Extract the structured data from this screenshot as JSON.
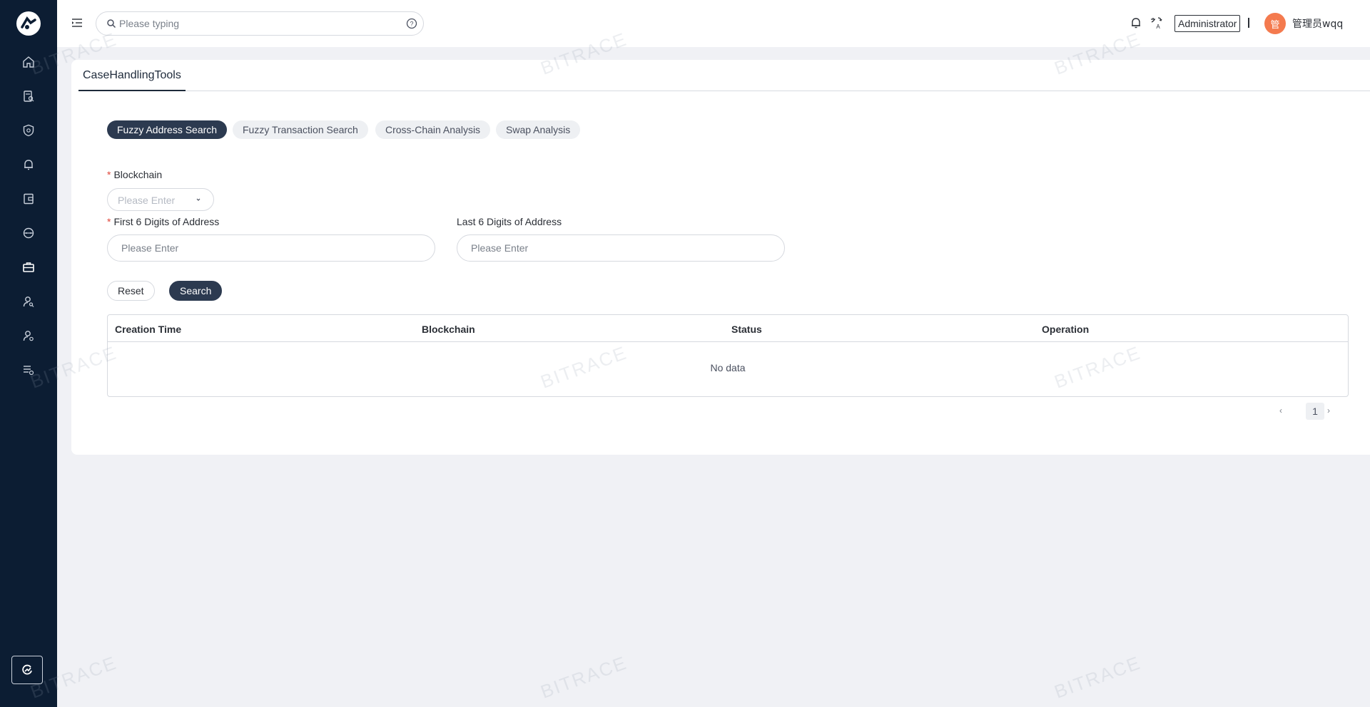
{
  "colors": {
    "sidebar_bg": "#0c1d33",
    "accent": "#2c3a50",
    "avatar_bg": "#f47a4e",
    "required": "#e0463a"
  },
  "sidebar": {
    "items": [
      {
        "icon": "home-icon"
      },
      {
        "icon": "document-search-icon"
      },
      {
        "icon": "shield-icon"
      },
      {
        "icon": "bell-icon"
      },
      {
        "icon": "wallet-icon"
      },
      {
        "icon": "network-icon"
      },
      {
        "icon": "briefcase-icon"
      },
      {
        "icon": "user-search-icon"
      },
      {
        "icon": "user-settings-icon"
      },
      {
        "icon": "report-list-icon"
      }
    ]
  },
  "header": {
    "search_placeholder": "Please typing",
    "role": "Administrator",
    "avatar_char": "管",
    "username": "管理员wqq"
  },
  "page": {
    "tab": "CaseHandlingTools",
    "segments": [
      "Fuzzy Address Search",
      "Fuzzy Transaction Search",
      "Cross-Chain Analysis",
      "Swap Analysis"
    ],
    "form": {
      "blockchain_label": "Blockchain",
      "blockchain_placeholder": "Please Enter",
      "first6_label": "First 6 Digits of Address",
      "first6_placeholder": "Please Enter",
      "last6_label": "Last 6 Digits of Address",
      "last6_placeholder": "Please Enter",
      "required_mark": "*"
    },
    "buttons": {
      "reset": "Reset",
      "search": "Search"
    },
    "table": {
      "columns": [
        "Creation Time",
        "Blockchain",
        "Status",
        "Operation"
      ],
      "empty": "No data"
    },
    "pagination": {
      "prev": "‹",
      "page": "1",
      "next": "›"
    }
  },
  "watermark": "BITRACE"
}
